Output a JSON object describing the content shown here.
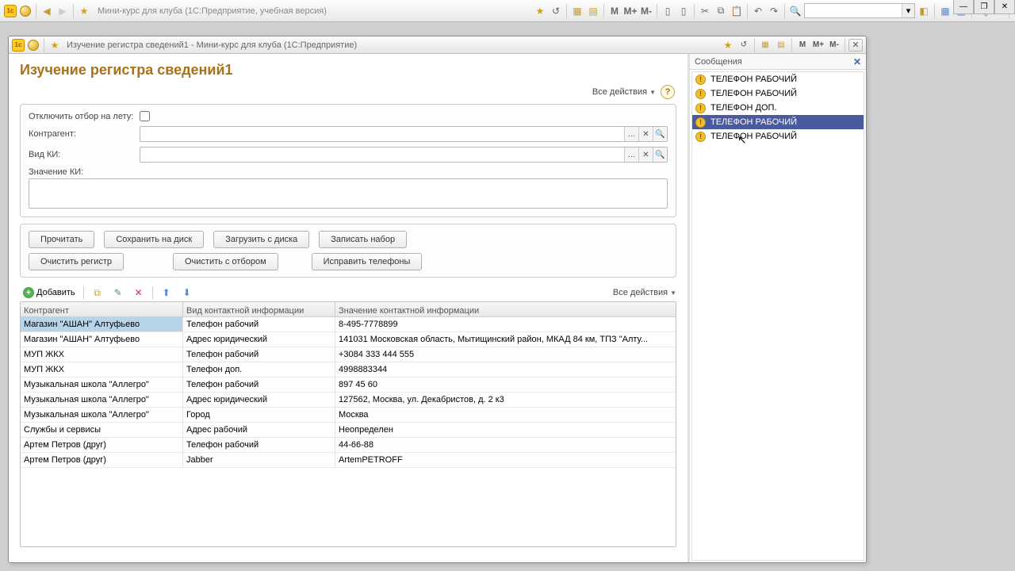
{
  "main_toolbar": {
    "title": "Мини-курс для клуба  (1С:Предприятие, учебная версия)",
    "m_labels": [
      "M",
      "M+",
      "M-"
    ]
  },
  "inner_window": {
    "title": "Изучение регистра сведений1 - Мини-курс для клуба  (1С:Предприятие)"
  },
  "page": {
    "heading": "Изучение регистра сведений1",
    "all_actions": "Все действия",
    "help": "?"
  },
  "filters": {
    "disable_filter_label": "Отключить отбор на лету:",
    "counterparty_label": "Контрагент:",
    "ci_type_label": "Вид КИ:",
    "ci_value_label": "Значение КИ:",
    "counterparty_value": "",
    "ci_type_value": ""
  },
  "buttons": {
    "read": "Прочитать",
    "save_disk": "Сохранить на диск",
    "load_disk": "Загрузить с диска",
    "write_set": "Записать набор",
    "clear_register": "Очистить регистр",
    "clear_filter": "Очистить с отбором",
    "fix_phones": "Исправить телефоны"
  },
  "table_toolbar": {
    "add": "Добавить",
    "all_actions": "Все действия"
  },
  "table": {
    "columns": [
      "Контрагент",
      "Вид контактной информации",
      "Значение контактной информации"
    ],
    "rows": [
      [
        "Магазин \"АШАН\" Алтуфьево",
        "Телефон рабочий",
        "8-495-7778899"
      ],
      [
        "Магазин \"АШАН\" Алтуфьево",
        "Адрес юридический",
        "141031 Московская область, Мытищинский район, МКАД 84 км, ТПЗ \"Алту..."
      ],
      [
        "МУП ЖКХ",
        "Телефон рабочий",
        "+3084 333 444 555"
      ],
      [
        "МУП ЖКХ",
        "Телефон доп.",
        "4998883344"
      ],
      [
        "Музыкальная школа \"Аллегро\"",
        "Телефон рабочий",
        "897 45 60"
      ],
      [
        "Музыкальная школа \"Аллегро\"",
        "Адрес юридический",
        "127562, Москва, ул. Декабристов, д. 2 к3"
      ],
      [
        "Музыкальная школа \"Аллегро\"",
        "Город",
        "Москва"
      ],
      [
        "Службы и сервисы",
        "Адрес рабочий",
        "Неопределен"
      ],
      [
        "Артем Петров (друг)",
        "Телефон рабочий",
        "44-66-88"
      ],
      [
        "Артем Петров (друг)",
        "Jabber",
        "ArtemPETROFF"
      ]
    ],
    "selected": 0
  },
  "messages": {
    "title": "Сообщения",
    "items": [
      "ТЕЛЕФОН РАБОЧИЙ",
      "ТЕЛЕФОН РАБОЧИЙ",
      "ТЕЛЕФОН ДОП.",
      "ТЕЛЕФОН РАБОЧИЙ",
      "ТЕЛЕФОН РАБОЧИЙ"
    ],
    "selected": 3
  }
}
